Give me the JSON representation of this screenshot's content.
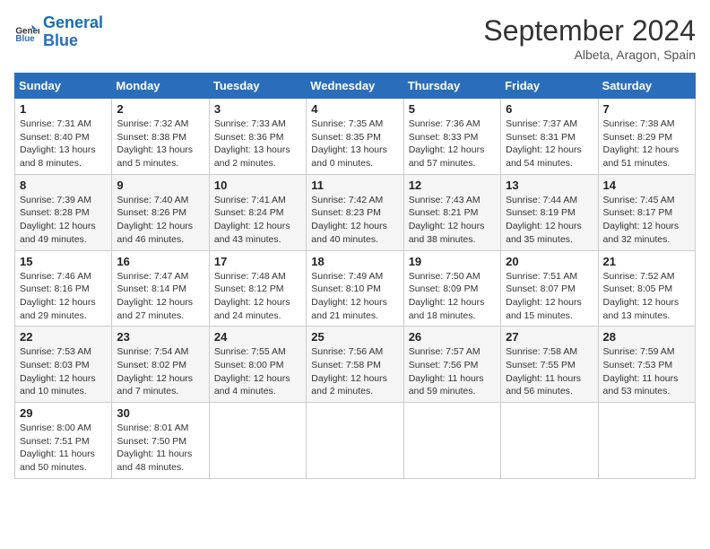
{
  "header": {
    "logo_line1": "General",
    "logo_line2": "Blue",
    "month": "September 2024",
    "location": "Albeta, Aragon, Spain"
  },
  "days_of_week": [
    "Sunday",
    "Monday",
    "Tuesday",
    "Wednesday",
    "Thursday",
    "Friday",
    "Saturday"
  ],
  "weeks": [
    [
      {
        "day": "1",
        "sunrise": "7:31 AM",
        "sunset": "8:40 PM",
        "daylight": "13 hours and 8 minutes."
      },
      {
        "day": "2",
        "sunrise": "7:32 AM",
        "sunset": "8:38 PM",
        "daylight": "13 hours and 5 minutes."
      },
      {
        "day": "3",
        "sunrise": "7:33 AM",
        "sunset": "8:36 PM",
        "daylight": "13 hours and 2 minutes."
      },
      {
        "day": "4",
        "sunrise": "7:35 AM",
        "sunset": "8:35 PM",
        "daylight": "13 hours and 0 minutes."
      },
      {
        "day": "5",
        "sunrise": "7:36 AM",
        "sunset": "8:33 PM",
        "daylight": "12 hours and 57 minutes."
      },
      {
        "day": "6",
        "sunrise": "7:37 AM",
        "sunset": "8:31 PM",
        "daylight": "12 hours and 54 minutes."
      },
      {
        "day": "7",
        "sunrise": "7:38 AM",
        "sunset": "8:29 PM",
        "daylight": "12 hours and 51 minutes."
      }
    ],
    [
      {
        "day": "8",
        "sunrise": "7:39 AM",
        "sunset": "8:28 PM",
        "daylight": "12 hours and 49 minutes."
      },
      {
        "day": "9",
        "sunrise": "7:40 AM",
        "sunset": "8:26 PM",
        "daylight": "12 hours and 46 minutes."
      },
      {
        "day": "10",
        "sunrise": "7:41 AM",
        "sunset": "8:24 PM",
        "daylight": "12 hours and 43 minutes."
      },
      {
        "day": "11",
        "sunrise": "7:42 AM",
        "sunset": "8:23 PM",
        "daylight": "12 hours and 40 minutes."
      },
      {
        "day": "12",
        "sunrise": "7:43 AM",
        "sunset": "8:21 PM",
        "daylight": "12 hours and 38 minutes."
      },
      {
        "day": "13",
        "sunrise": "7:44 AM",
        "sunset": "8:19 PM",
        "daylight": "12 hours and 35 minutes."
      },
      {
        "day": "14",
        "sunrise": "7:45 AM",
        "sunset": "8:17 PM",
        "daylight": "12 hours and 32 minutes."
      }
    ],
    [
      {
        "day": "15",
        "sunrise": "7:46 AM",
        "sunset": "8:16 PM",
        "daylight": "12 hours and 29 minutes."
      },
      {
        "day": "16",
        "sunrise": "7:47 AM",
        "sunset": "8:14 PM",
        "daylight": "12 hours and 27 minutes."
      },
      {
        "day": "17",
        "sunrise": "7:48 AM",
        "sunset": "8:12 PM",
        "daylight": "12 hours and 24 minutes."
      },
      {
        "day": "18",
        "sunrise": "7:49 AM",
        "sunset": "8:10 PM",
        "daylight": "12 hours and 21 minutes."
      },
      {
        "day": "19",
        "sunrise": "7:50 AM",
        "sunset": "8:09 PM",
        "daylight": "12 hours and 18 minutes."
      },
      {
        "day": "20",
        "sunrise": "7:51 AM",
        "sunset": "8:07 PM",
        "daylight": "12 hours and 15 minutes."
      },
      {
        "day": "21",
        "sunrise": "7:52 AM",
        "sunset": "8:05 PM",
        "daylight": "12 hours and 13 minutes."
      }
    ],
    [
      {
        "day": "22",
        "sunrise": "7:53 AM",
        "sunset": "8:03 PM",
        "daylight": "12 hours and 10 minutes."
      },
      {
        "day": "23",
        "sunrise": "7:54 AM",
        "sunset": "8:02 PM",
        "daylight": "12 hours and 7 minutes."
      },
      {
        "day": "24",
        "sunrise": "7:55 AM",
        "sunset": "8:00 PM",
        "daylight": "12 hours and 4 minutes."
      },
      {
        "day": "25",
        "sunrise": "7:56 AM",
        "sunset": "7:58 PM",
        "daylight": "12 hours and 2 minutes."
      },
      {
        "day": "26",
        "sunrise": "7:57 AM",
        "sunset": "7:56 PM",
        "daylight": "11 hours and 59 minutes."
      },
      {
        "day": "27",
        "sunrise": "7:58 AM",
        "sunset": "7:55 PM",
        "daylight": "11 hours and 56 minutes."
      },
      {
        "day": "28",
        "sunrise": "7:59 AM",
        "sunset": "7:53 PM",
        "daylight": "11 hours and 53 minutes."
      }
    ],
    [
      {
        "day": "29",
        "sunrise": "8:00 AM",
        "sunset": "7:51 PM",
        "daylight": "11 hours and 50 minutes."
      },
      {
        "day": "30",
        "sunrise": "8:01 AM",
        "sunset": "7:50 PM",
        "daylight": "11 hours and 48 minutes."
      },
      null,
      null,
      null,
      null,
      null
    ]
  ]
}
